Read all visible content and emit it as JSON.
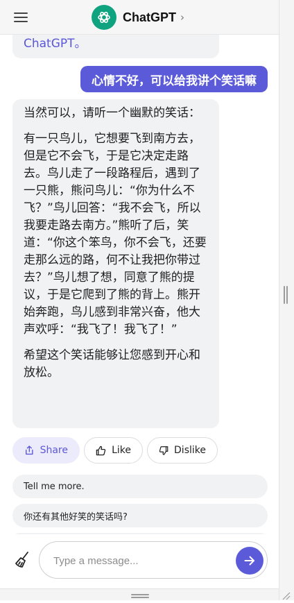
{
  "header": {
    "title": "ChatGPT",
    "chevron": "›",
    "menu_icon": "hamburger-menu-icon",
    "logo_icon": "openai-logo-icon"
  },
  "chat": {
    "previous_assistant_tail": "ChatGPT。",
    "user_message": "心情不好，可以给我讲个笑话嘛",
    "assistant_message": {
      "paragraphs": [
        "当然可以，请听一个幽默的笑话：",
        "有一只鸟儿，它想要飞到南方去，但是它不会飞，于是它决定走路去。鸟儿走了一段路程后，遇到了一只熊，熊问鸟儿：“你为什么不飞？”鸟儿回答：“我不会飞，所以我要走路去南方。”熊听了后，笑道：“你这个笨鸟，你不会飞，还要走那么远的路，何不让我把你带过去？”鸟儿想了想，同意了熊的提议，于是它爬到了熊的背上。熊开始奔跑，鸟儿感到非常兴奋，他大声欢呼：“我飞了！我飞了！”",
        "希望这个笑话能够让您感到开心和放松。"
      ]
    },
    "actions": {
      "share": "Share",
      "like": "Like",
      "dislike": "Dislike"
    },
    "suggestions": [
      "Tell me more.",
      "你还有其他好笑的笑话吗?"
    ]
  },
  "composer": {
    "placeholder": "Type a message...",
    "value": "",
    "clear_icon": "broom-icon",
    "send_icon": "arrow-right-icon"
  },
  "colors": {
    "accent": "#5b5bd9",
    "logo": "#10a37f",
    "bubble": "#f1f2f4"
  }
}
